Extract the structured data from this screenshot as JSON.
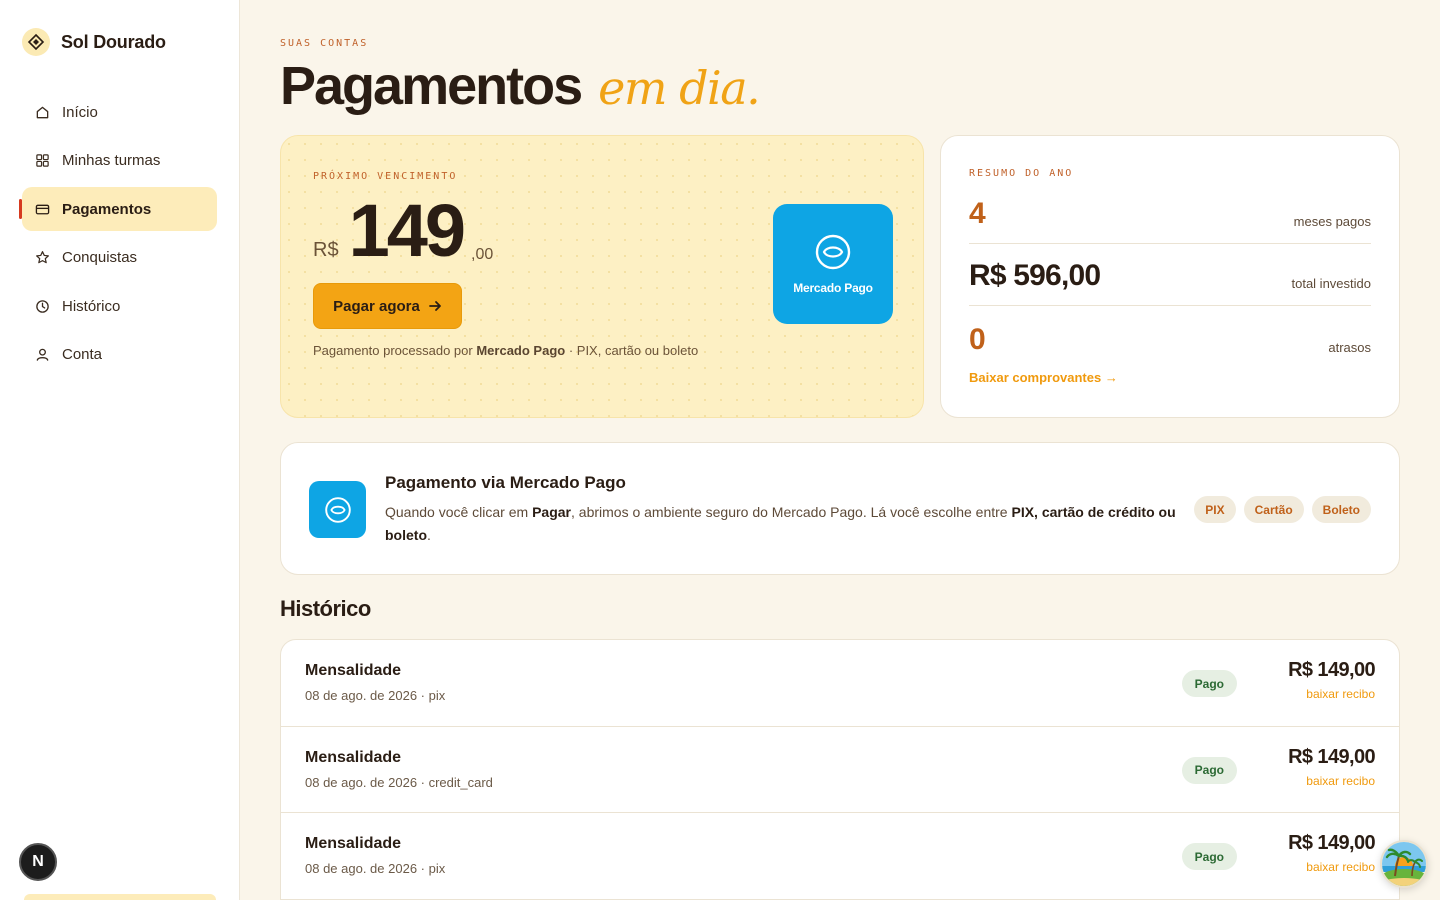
{
  "brand": {
    "name": "Sol Dourado",
    "logo_icon": "diamond-sun-icon"
  },
  "sidebar": {
    "items": [
      {
        "label": "Início",
        "icon": "home-icon",
        "active": false
      },
      {
        "label": "Minhas turmas",
        "icon": "grid-icon",
        "active": false
      },
      {
        "label": "Pagamentos",
        "icon": "credit-card-icon",
        "active": true
      },
      {
        "label": "Conquistas",
        "icon": "star-icon",
        "active": false
      },
      {
        "label": "Histórico",
        "icon": "clock-icon",
        "active": false
      },
      {
        "label": "Conta",
        "icon": "user-icon",
        "active": false
      }
    ],
    "badge_letter": "N"
  },
  "page": {
    "eyebrow": "SUAS CONTAS",
    "title": "Pagamentos",
    "title_accent": "em dia."
  },
  "due": {
    "eyebrow": "PRÓXIMO VENCIMENTO",
    "currency": "R$",
    "amount_int": "149",
    "amount_cents": ",00",
    "pay_button": "Pagar agora",
    "note_prefix": "Pagamento processado por",
    "note_provider": "Mercado Pago",
    "note_suffix": "· PIX, cartão ou boleto",
    "provider_logo_text": "Mercado Pago"
  },
  "summary": {
    "eyebrow": "RESUMO DO ANO",
    "rows": [
      {
        "value": "4",
        "label": "meses pagos"
      },
      {
        "value": "R$ 596,00",
        "label": "total investido"
      },
      {
        "value": "0",
        "label": "atrasos"
      }
    ],
    "link": "Baixar comprovantes →"
  },
  "info": {
    "title": "Pagamento via Mercado Pago",
    "text_1": "Quando você clicar em",
    "text_bold_1": "Pagar",
    "text_2": ", abrimos o ambiente seguro do Mercado Pago. Lá você escolhe entre",
    "text_bold_2": "PIX, cartão de crédito ou boleto",
    "text_3": ".",
    "chips": [
      "PIX",
      "Cartão",
      "Boleto"
    ]
  },
  "history": {
    "title": "Histórico",
    "rows": [
      {
        "name": "Mensalidade",
        "meta": "08 de ago. de 2026 · pix",
        "status": "Pago",
        "amount": "R$ 149,00",
        "link": "baixar recibo"
      },
      {
        "name": "Mensalidade",
        "meta": "08 de ago. de 2026 · credit_card",
        "status": "Pago",
        "amount": "R$ 149,00",
        "link": "baixar recibo"
      },
      {
        "name": "Mensalidade",
        "meta": "08 de ago. de 2026 · pix",
        "status": "Pago",
        "amount": "R$ 149,00",
        "link": "baixar recibo"
      }
    ]
  },
  "colors": {
    "accent": "#f3a414",
    "accent_dark": "#c0611a",
    "mercado_pago": "#0ea5e4",
    "background": "#faf5ea",
    "due_card": "#fdf0c4",
    "paid_badge_bg": "#e6efe3",
    "paid_badge_text": "#2c6a34"
  }
}
